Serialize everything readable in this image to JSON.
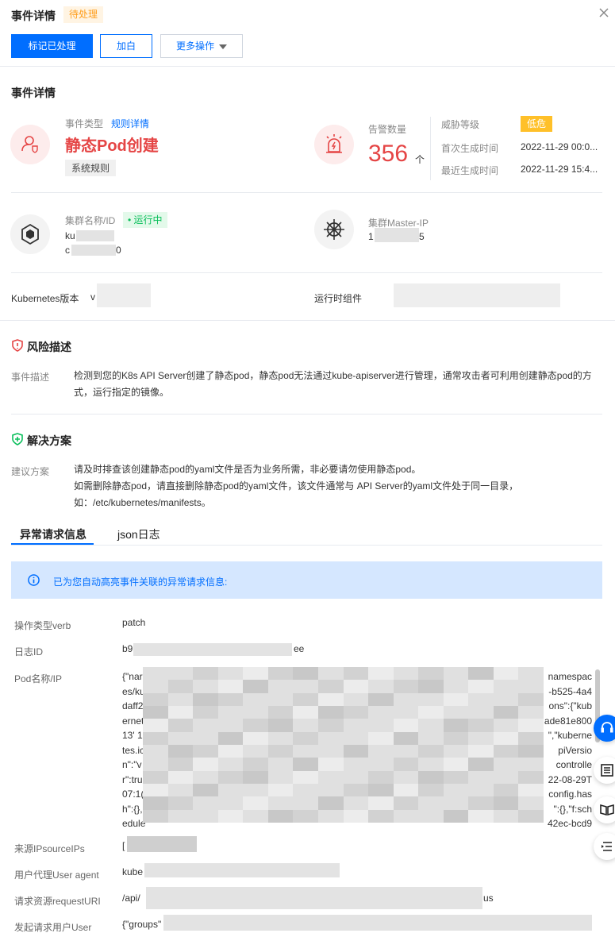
{
  "header": {
    "title": "事件详情",
    "status": "待处理",
    "btn_mark": "标记已处理",
    "btn_whitelist": "加白",
    "btn_more": "更多操作"
  },
  "event": {
    "section_title": "事件详情",
    "type_label": "事件类型",
    "rule_link": "规则详情",
    "name": "静态Pod创建",
    "rule_tag": "系统规则",
    "alert_label": "告警数量",
    "alert_count": "356",
    "alert_unit": "个",
    "threat_label": "威胁等级",
    "threat_level": "低危",
    "first_label": "首次生成时间",
    "first_time": "2022-11-29 00:0...",
    "last_label": "最近生成时间",
    "last_time": "2022-11-29 15:4...",
    "cluster_label": "集群名称/ID",
    "cluster_status": "运行中",
    "cluster_name_prefix": "ku",
    "cluster_id_prefix": "c",
    "cluster_id_suffix": "0",
    "master_label": "集群Master-IP",
    "master_prefix": "1",
    "master_suffix": "5",
    "k8s_label": "Kubernetes版本",
    "k8s_value": "v",
    "runtime_label": "运行时组件"
  },
  "risk": {
    "title": "风险描述",
    "label": "事件描述",
    "text_1": "检测到您的K8s API Server创建了静态pod，静态pod无法通过kube-apiserver进行管理，通常攻击者可利用创建静态pod的方",
    "text_2": "式，运行指定的镜像。"
  },
  "solution": {
    "title": "解决方案",
    "label": "建议方案",
    "line_1": "请及时排查该创建静态pod的yaml文件是否为业务所需，非必要请勿使用静态pod。",
    "line_2": "如需删除静态pod，请直接删除静态pod的yaml文件，该文件通常与 API Server的yaml文件处于同一目录，",
    "line_3": "如：/etc/kubernetes/manifests。"
  },
  "tabs": [
    "异常请求信息",
    "json日志"
  ],
  "info_notice": "已为您自动高亮事件关联的异常请求信息:",
  "details": {
    "verb_label": "操作类型verb",
    "verb_value": "patch",
    "logid_label": "日志ID",
    "logid_prefix": "b9",
    "logid_suffix": "ee",
    "pod_label": "Pod名称/IP",
    "pod_left": [
      "{\"nar",
      "es/ku",
      "daff2",
      "ernet",
      "13' 1",
      "tes.ic",
      "n\":\"v",
      "r\":tru",
      "07:1(",
      "h\":{},",
      "edule"
    ],
    "pod_right": [
      "namespac",
      "-b525-4a4",
      "ons\":{\"kub",
      "ade81e800",
      "\",\"kuberne",
      "piVersio",
      "controlle",
      "22-08-29T",
      "config.has",
      "\":{},\"f:sch",
      "42ec-bcd9"
    ],
    "src_label": "来源IPsourceIPs",
    "src_value": "[",
    "ua_label": "用户代理User agent",
    "ua_value": "kube",
    "uri_label": "请求资源requestURI",
    "uri_prefix": "/api/",
    "uri_suffix": "us",
    "user_label": "发起请求用户User",
    "user_value": "{\"groups\""
  },
  "icons": [
    "close-icon",
    "user-shield-icon",
    "alarm-icon",
    "hexagon-icon",
    "helm-wheel-icon",
    "risk-shield-icon",
    "solution-shield-icon",
    "info-icon",
    "headset-icon",
    "list-icon",
    "book-icon",
    "menu-icon"
  ],
  "colors": {
    "primary": "#006eff",
    "danger": "#e54545",
    "warning": "#ff9c19",
    "success": "#0abf5b",
    "low": "#ffc029"
  }
}
